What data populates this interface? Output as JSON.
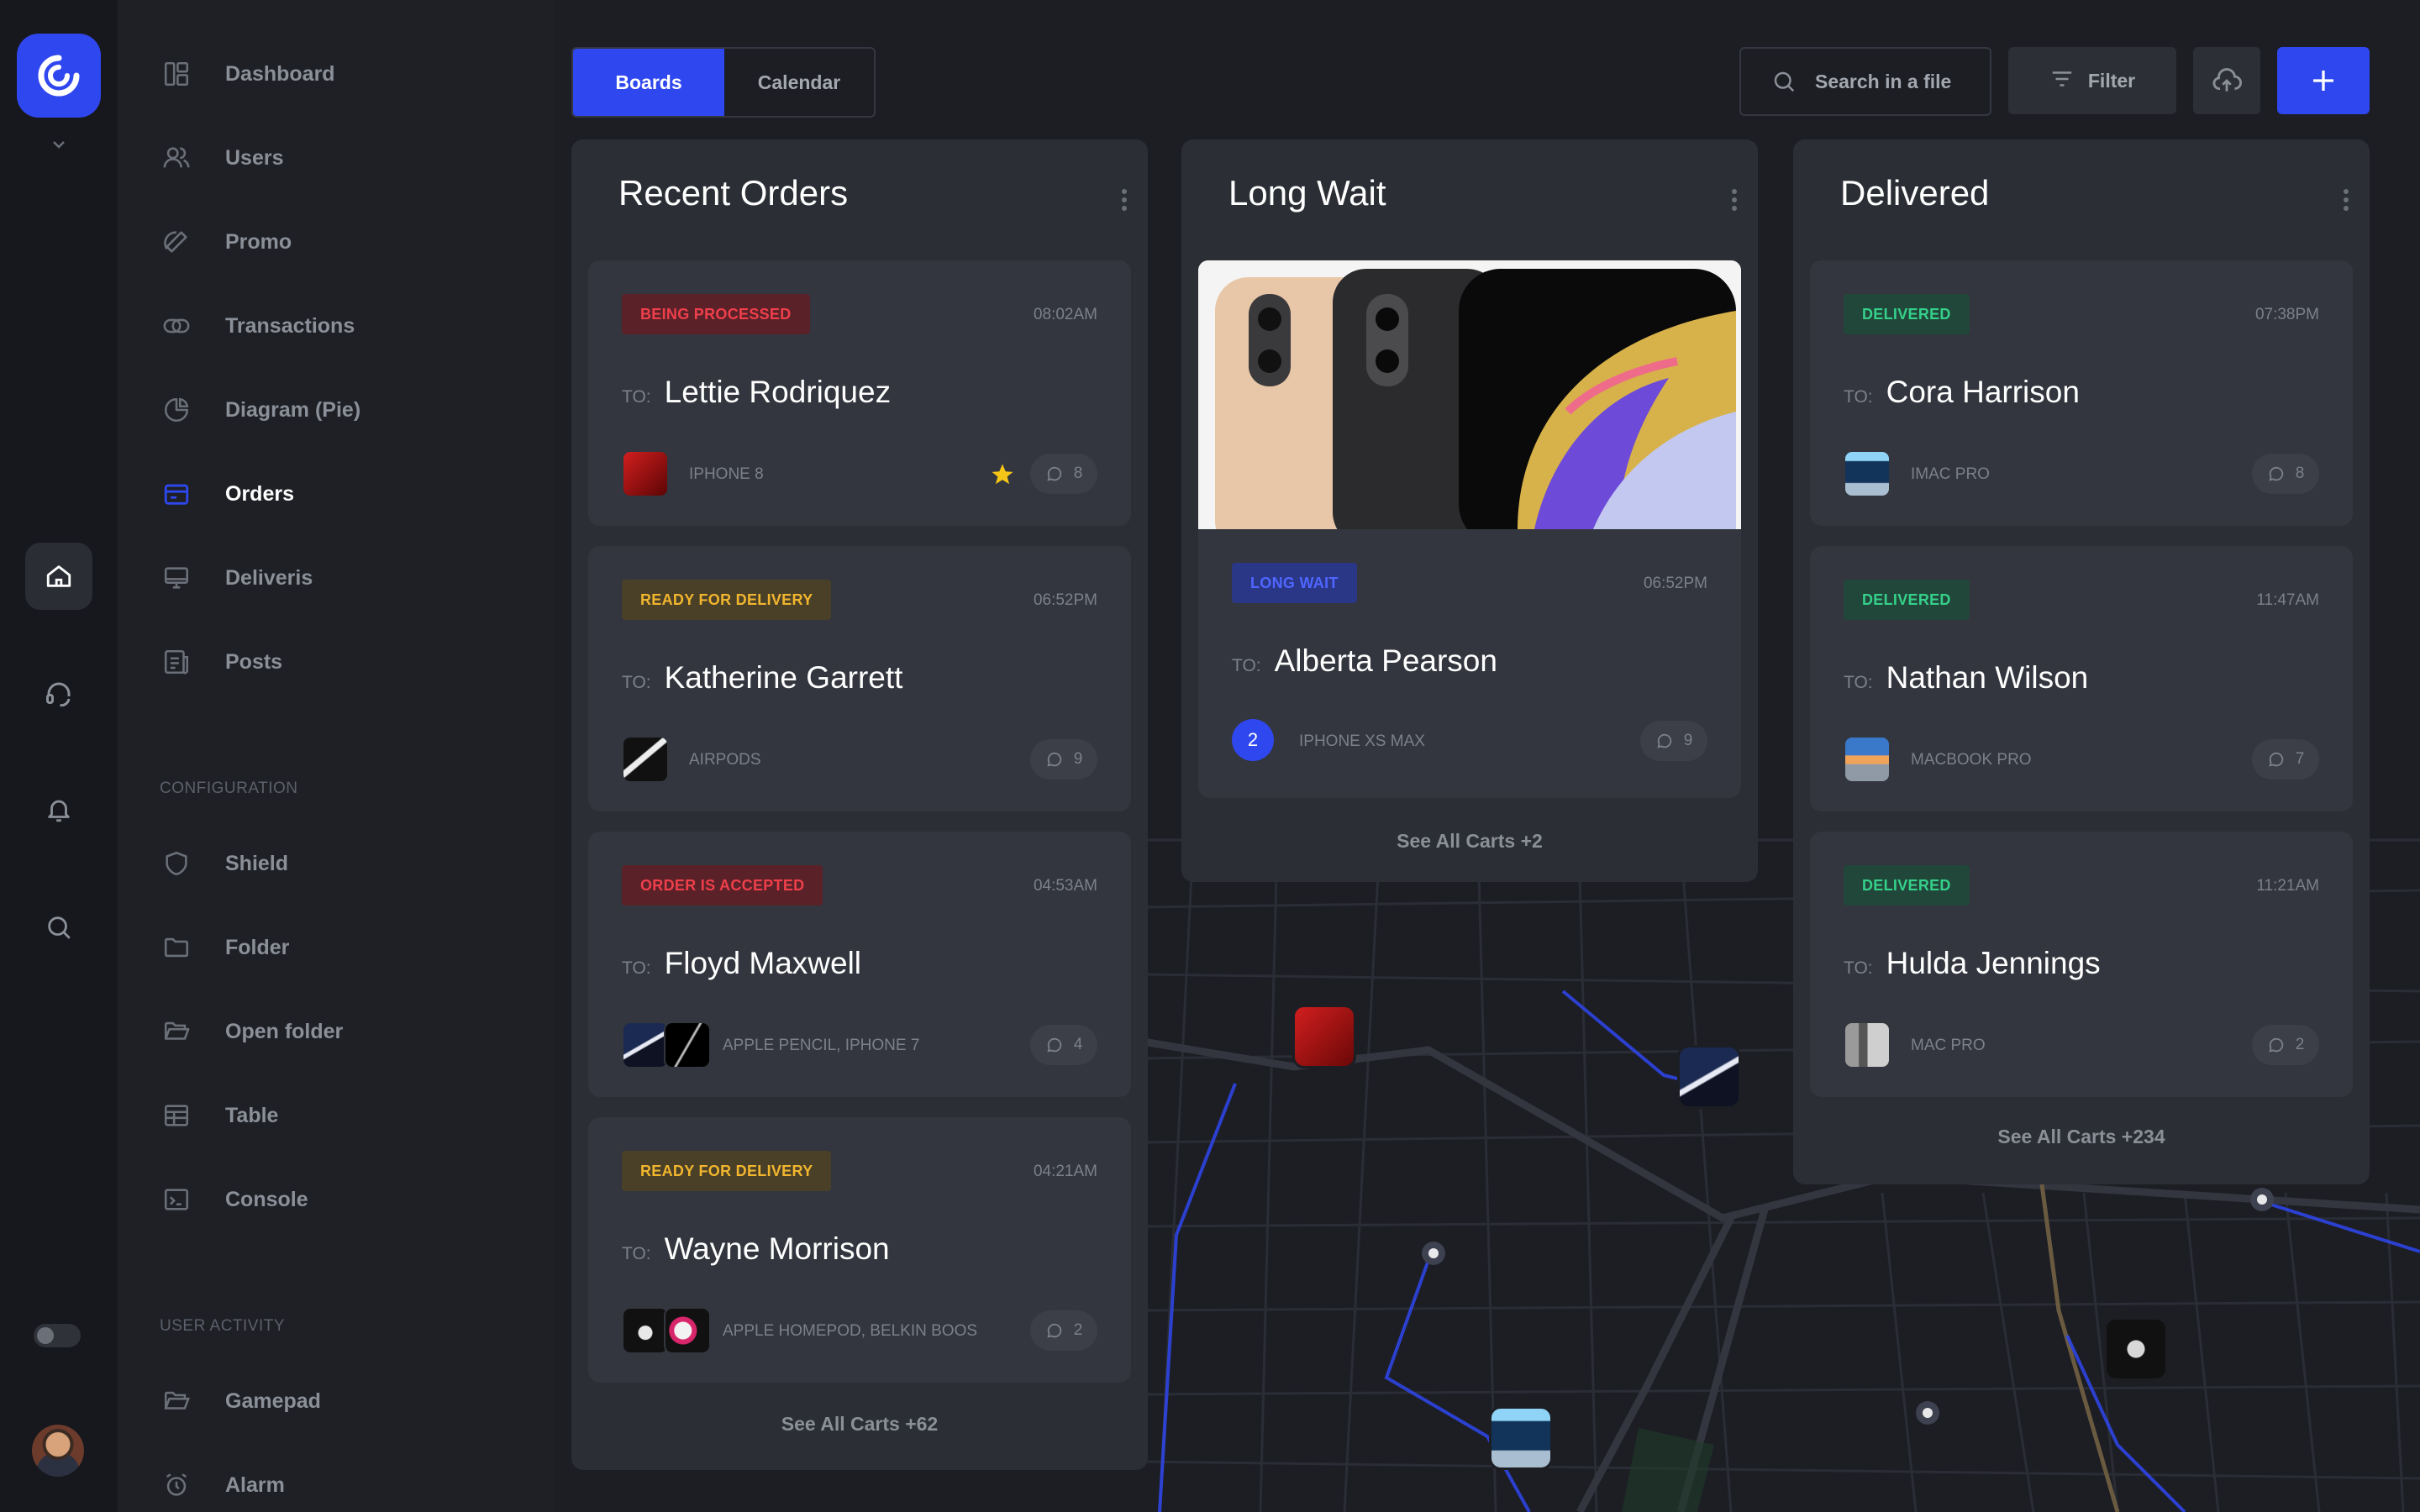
{
  "brand": {
    "accent": "#2f47ee"
  },
  "nav": {
    "items": [
      {
        "label": "Dashboard",
        "icon": "dashboard-icon"
      },
      {
        "label": "Users",
        "icon": "users-icon"
      },
      {
        "label": "Promo",
        "icon": "promo-icon"
      },
      {
        "label": "Transactions",
        "icon": "transactions-icon"
      },
      {
        "label": "Diagram (Pie)",
        "icon": "pie-chart-icon"
      },
      {
        "label": "Orders",
        "icon": "orders-icon",
        "active": true
      },
      {
        "label": "Deliveris",
        "icon": "monitor-icon"
      },
      {
        "label": "Posts",
        "icon": "posts-icon"
      }
    ],
    "config_title": "CONFIGURATION",
    "config_items": [
      {
        "label": "Shield",
        "icon": "shield-icon"
      },
      {
        "label": "Folder",
        "icon": "folder-icon"
      },
      {
        "label": "Open folder",
        "icon": "open-folder-icon"
      },
      {
        "label": "Table",
        "icon": "table-icon"
      },
      {
        "label": "Console",
        "icon": "console-icon"
      }
    ],
    "activity_title": "USER ACTIVITY",
    "activity_items": [
      {
        "label": "Gamepad",
        "icon": "gamepad-icon"
      },
      {
        "label": "Alarm",
        "icon": "alarm-icon"
      }
    ]
  },
  "topbar": {
    "tabs": [
      {
        "label": "Boards",
        "active": true
      },
      {
        "label": "Calendar"
      }
    ],
    "search_placeholder": "Search in a file",
    "filter_label": "Filter"
  },
  "columns": {
    "recent": {
      "title": "Recent Orders",
      "see_all": "See All Carts +62",
      "cards": [
        {
          "status": "BEING PROCESSED",
          "status_color": "red",
          "time": "08:02AM",
          "to_label": "TO:",
          "name": "Lettie Rodriquez",
          "products": "IPHONE 8",
          "comments": "8",
          "starred": true
        },
        {
          "status": "READY FOR DELIVERY",
          "status_color": "yellow",
          "time": "06:52PM",
          "to_label": "TO:",
          "name": "Katherine Garrett",
          "products": "AIRPODS",
          "comments": "9"
        },
        {
          "status": "ORDER IS ACCEPTED",
          "status_color": "red",
          "time": "04:53AM",
          "to_label": "TO:",
          "name": "Floyd Maxwell",
          "products": "APPLE PENCIL, IPHONE 7",
          "comments": "4"
        },
        {
          "status": "READY FOR DELIVERY",
          "status_color": "yellow",
          "time": "04:21AM",
          "to_label": "TO:",
          "name": "Wayne Morrison",
          "products": "APPLE HOMEPOD, BELKIN BOOS",
          "comments": "2"
        }
      ]
    },
    "longwait": {
      "title": "Long Wait",
      "see_all": "See All Carts +2",
      "card": {
        "status": "LONG WAIT",
        "status_color": "blue",
        "time": "06:52PM",
        "to_label": "TO:",
        "name": "Alberta Pearson",
        "qty": "2",
        "products": "IPHONE XS MAX",
        "comments": "9"
      }
    },
    "delivered": {
      "title": "Delivered",
      "see_all": "See All Carts +234",
      "cards": [
        {
          "status": "DELIVERED",
          "status_color": "green",
          "time": "07:38PM",
          "to_label": "TO:",
          "name": "Cora Harrison",
          "products": "IMAC PRO",
          "comments": "8"
        },
        {
          "status": "DELIVERED",
          "status_color": "green",
          "time": "11:47AM",
          "to_label": "TO:",
          "name": "Nathan Wilson",
          "products": "MACBOOK PRO",
          "comments": "7"
        },
        {
          "status": "DELIVERED",
          "status_color": "green",
          "time": "11:21AM",
          "to_label": "TO:",
          "name": "Hulda Jennings",
          "products": "MAC PRO",
          "comments": "2"
        }
      ]
    }
  }
}
